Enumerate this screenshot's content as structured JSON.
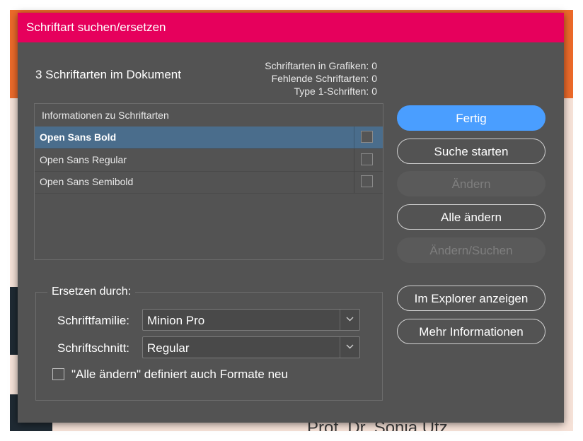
{
  "dialog": {
    "title": "Schriftart suchen/ersetzen",
    "doc_count": "3 Schriftarten im Dokument",
    "stats": [
      "Schriftarten in Grafiken: 0",
      "Fehlende Schriftarten: 0",
      "Type 1-Schriften: 0"
    ],
    "list_header": "Informationen zu Schriftarten",
    "fonts": [
      {
        "name": "Open Sans Bold",
        "selected": true
      },
      {
        "name": "Open Sans Regular",
        "selected": false
      },
      {
        "name": "Open Sans Semibold",
        "selected": false
      }
    ],
    "replace": {
      "legend": "Ersetzen durch:",
      "family_label": "Schriftfamilie:",
      "family_value": "Minion Pro",
      "style_label": "Schriftschnitt:",
      "style_value": "Regular",
      "redefine_label": "\"Alle ändern\" definiert auch Formate neu",
      "redefine_checked": false
    },
    "buttons": {
      "done": "Fertig",
      "find": "Suche starten",
      "change": "Ändern",
      "change_all": "Alle ändern",
      "change_find": "Ändern/Suchen",
      "reveal": "Im Explorer anzeigen",
      "more_info": "Mehr Informationen"
    }
  },
  "background": {
    "bottom_text": "Prof. Dr. Sonia Utz"
  },
  "colors": {
    "titlebar": "#e6005c",
    "dialog_bg": "#535353",
    "primary_button": "#4a9eff",
    "selection": "#4a6d8c"
  }
}
